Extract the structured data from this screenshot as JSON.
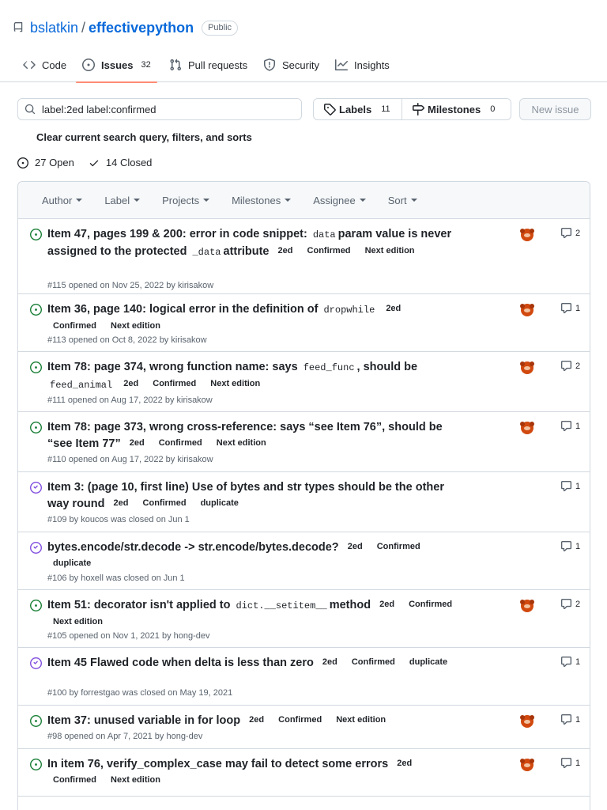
{
  "repo": {
    "owner": "bslatkin",
    "name": "effectivepython",
    "visibility": "Public"
  },
  "tabs": [
    {
      "label": "Code",
      "icon": "code-icon"
    },
    {
      "label": "Issues",
      "count": "32",
      "icon": "issue-opened-icon"
    },
    {
      "label": "Pull requests",
      "icon": "git-pull-request-icon"
    },
    {
      "label": "Security",
      "icon": "shield-icon"
    },
    {
      "label": "Insights",
      "icon": "graph-icon"
    }
  ],
  "search": {
    "value": "label:2ed label:confirmed"
  },
  "labels_button": {
    "label": "Labels",
    "count": "11"
  },
  "milestones_button": {
    "label": "Milestones",
    "count": "0"
  },
  "new_issue": "New issue",
  "clear_filters": "Clear current search query, filters, and sorts",
  "states": {
    "open": "27 Open",
    "closed": "14 Closed"
  },
  "filters": [
    "Author",
    "Label",
    "Projects",
    "Milestones",
    "Assignee",
    "Sort"
  ],
  "colors": {
    "open": "#1a7f37",
    "closed": "#8250df",
    "accent": "#0969da",
    "tab_underline": "#fd8c73"
  },
  "issues": [
    {
      "state": "open",
      "parts": [
        "Item 47, pages 199 & 200: error in code snippet:",
        "data",
        "param value is never assigned to the protected",
        "_data",
        "attribute"
      ],
      "labels": [
        "2ed",
        "Confirmed",
        "Next edition"
      ],
      "meta": "#115 opened on Nov 25, 2022 by kirisakow",
      "comments": "2",
      "avatar": true
    },
    {
      "state": "open",
      "parts": [
        "Item 36, page 140: logical error in the definition of",
        "dropwhile"
      ],
      "labels": [
        "2ed",
        "Confirmed",
        "Next edition"
      ],
      "meta": "#113 opened on Oct 8, 2022 by kirisakow",
      "comments": "1",
      "avatar": true
    },
    {
      "state": "open",
      "parts": [
        "Item 78: page 374, wrong function name: says",
        "feed_func",
        ", should be",
        "feed_animal"
      ],
      "labels": [
        "2ed",
        "Confirmed",
        "Next edition"
      ],
      "meta": "#111 opened on Aug 17, 2022 by kirisakow",
      "comments": "2",
      "avatar": true
    },
    {
      "state": "open",
      "parts": [
        "Item 78: page 373, wrong cross-reference: says “see Item 76”, should be “see Item 77”"
      ],
      "labels": [
        "2ed",
        "Confirmed",
        "Next edition"
      ],
      "meta": "#110 opened on Aug 17, 2022 by kirisakow",
      "comments": "1",
      "avatar": true
    },
    {
      "state": "closed",
      "parts": [
        "Item 3: (page 10, first line) Use of bytes and str types should be the other way round"
      ],
      "labels": [
        "2ed",
        "Confirmed",
        "duplicate"
      ],
      "meta": "#109 by koucos was closed on Jun 1",
      "comments": "1",
      "avatar": false
    },
    {
      "state": "closed",
      "parts": [
        "bytes.encode/str.decode -> str.encode/bytes.decode?"
      ],
      "labels": [
        "2ed",
        "Confirmed",
        "duplicate"
      ],
      "meta": "#106 by hoxell was closed on Jun 1",
      "comments": "1",
      "avatar": false
    },
    {
      "state": "open",
      "parts": [
        "Item 51: decorator isn't applied to",
        "dict.__setitem__",
        "method"
      ],
      "labels": [
        "2ed",
        "Confirmed",
        "Next edition"
      ],
      "meta": "#105 opened on Nov 1, 2021 by hong-dev",
      "comments": "2",
      "avatar": true
    },
    {
      "state": "closed",
      "parts": [
        "Item 45 Flawed code when delta is less than zero"
      ],
      "labels": [
        "2ed",
        "Confirmed",
        "duplicate"
      ],
      "meta": "#100 by forrestgao was closed on May 19, 2021",
      "comments": "1",
      "avatar": false
    },
    {
      "state": "open",
      "parts": [
        "Item 37: unused variable in for loop"
      ],
      "labels": [
        "2ed",
        "Confirmed",
        "Next edition"
      ],
      "meta": "#98 opened on Apr 7, 2021 by hong-dev",
      "comments": "1",
      "avatar": true
    },
    {
      "state": "open",
      "parts": [
        "In item 76, verify_complex_case may fail to detect some errors"
      ],
      "labels": [
        "2ed",
        "Confirmed",
        "Next edition"
      ],
      "meta": "",
      "comments": "1",
      "avatar": true
    }
  ]
}
